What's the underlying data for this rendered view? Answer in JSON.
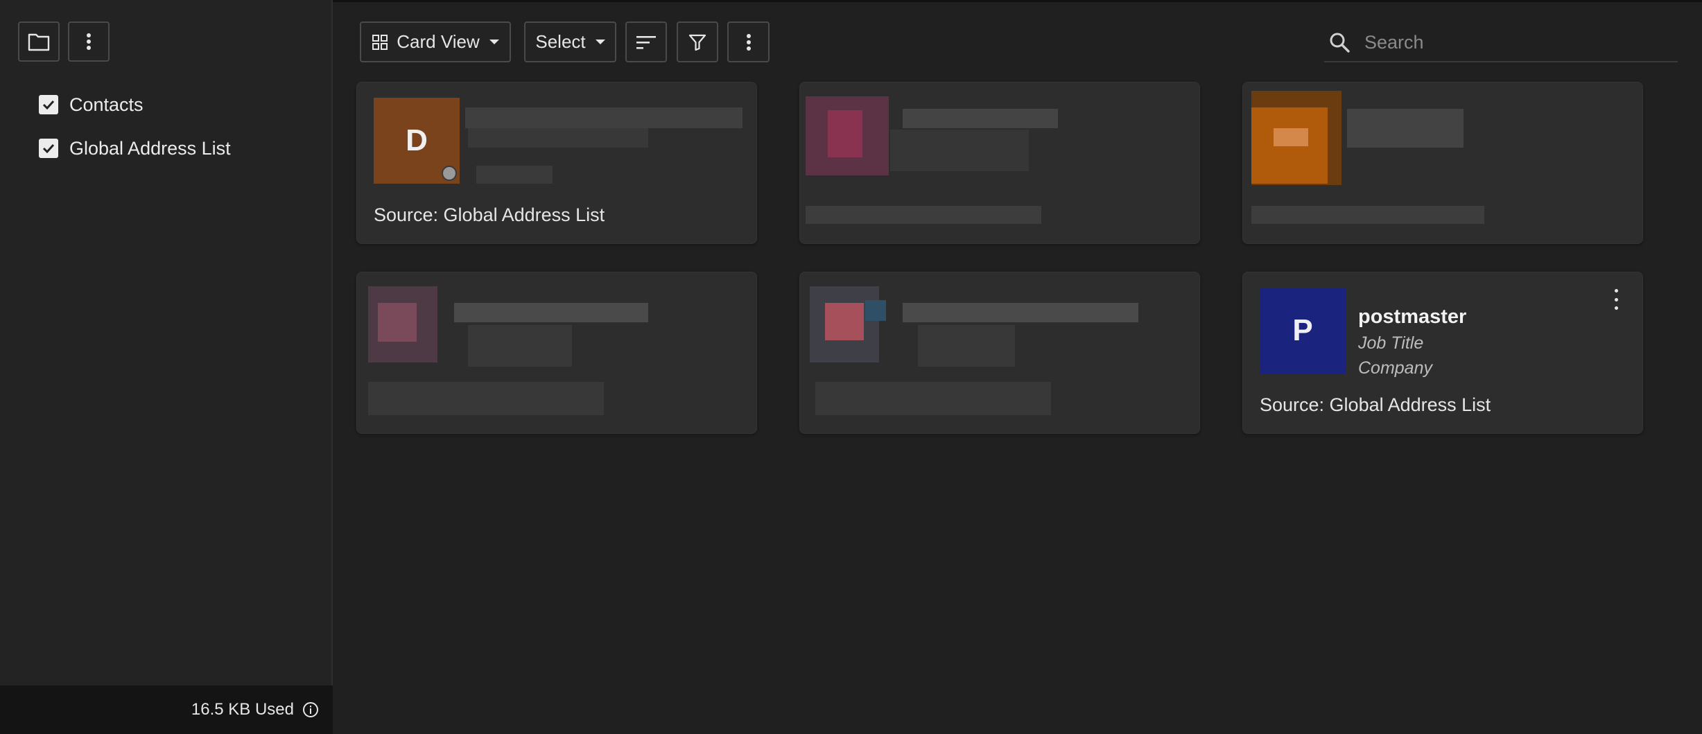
{
  "sidebar": {
    "address_books": [
      {
        "label": "Contacts",
        "checked": true
      },
      {
        "label": "Global Address List",
        "checked": true
      }
    ],
    "storage_used": "16.5 KB Used"
  },
  "toolbar": {
    "view_label": "Card View",
    "select_label": "Select",
    "search_placeholder": "Search"
  },
  "cards": [
    {
      "avatar_letter": "D",
      "avatar_color": "#7a431c",
      "source": "Source: Global Address List",
      "presence": "offline"
    },
    {
      "redacted": true
    },
    {
      "redacted": true
    },
    {
      "redacted": true
    },
    {
      "redacted": true
    },
    {
      "avatar_letter": "P",
      "avatar_color": "#1a237e",
      "name": "postmaster",
      "job_title": "Job Title",
      "company": "Company",
      "source": "Source: Global Address List"
    }
  ],
  "colors": {
    "background": "#202020",
    "sidebar": "#232323",
    "card": "#2d2d2d"
  }
}
